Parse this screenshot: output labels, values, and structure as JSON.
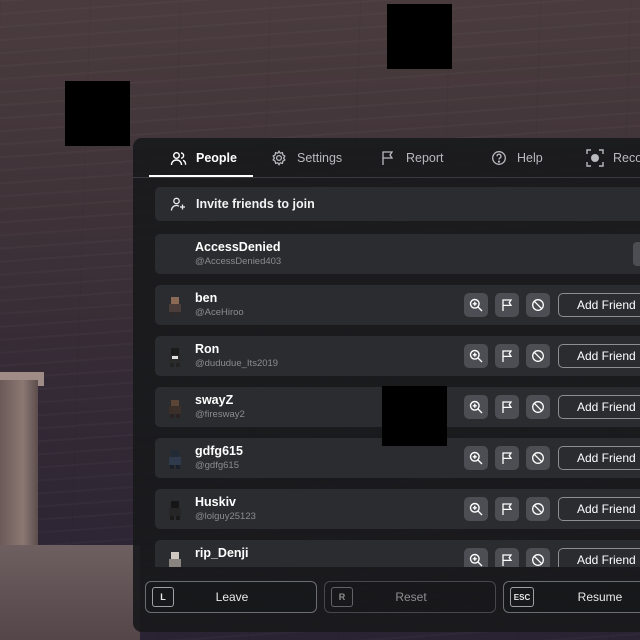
{
  "tabs": [
    {
      "label": "People",
      "icon": "people-icon",
      "active": true
    },
    {
      "label": "Settings",
      "icon": "gear-icon",
      "active": false
    },
    {
      "label": "Report",
      "icon": "flag-icon",
      "active": false
    },
    {
      "label": "Help",
      "icon": "question-icon",
      "active": false
    },
    {
      "label": "Reco",
      "icon": "record-icon",
      "active": false
    }
  ],
  "invite": {
    "label": "Invite friends to join",
    "icon": "add-person-icon"
  },
  "self_player": {
    "name": "AccessDenied",
    "username": "@AccessDenied403"
  },
  "players": [
    {
      "name": "ben",
      "username": "@AceHiroo",
      "add_label": "Add Friend"
    },
    {
      "name": "Ron",
      "username": "@dududue_Its2019",
      "add_label": "Add Friend"
    },
    {
      "name": "swayZ",
      "username": "@firesway2",
      "add_label": "Add Friend"
    },
    {
      "name": "gdfg615",
      "username": "@gdfg615",
      "add_label": "Add Friend"
    },
    {
      "name": "Huskiv",
      "username": "@lolguy25123",
      "add_label": "Add Friend"
    },
    {
      "name": "rip_Denji",
      "username": "",
      "add_label": "Add Friend"
    }
  ],
  "player_action_icons": [
    "inspect-icon",
    "flag-icon",
    "block-icon"
  ],
  "bottom_buttons": [
    {
      "key": "L",
      "label": "Leave"
    },
    {
      "key": "R",
      "label": "Reset"
    },
    {
      "key": "ESC",
      "label": "Resume"
    }
  ],
  "colors": {
    "panel": "#191a1c",
    "row": "#2b2c30",
    "action_button": "#4d4e53",
    "text": "#ffffff",
    "subtext": "#8b8c90"
  }
}
